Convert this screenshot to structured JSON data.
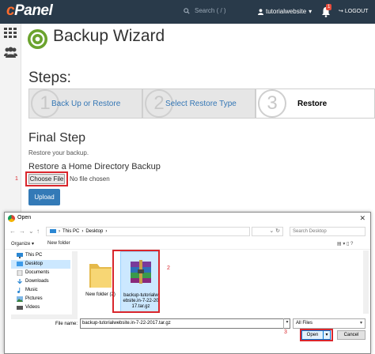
{
  "header": {
    "logo_c": "c",
    "logo_rest": "Panel",
    "search_placeholder": "Search ( / )",
    "username": "tutorialwebsite",
    "notification_count": "1",
    "logout_label": "LOGOUT"
  },
  "page": {
    "title": "Backup Wizard",
    "steps_heading": "Steps:",
    "steps": [
      {
        "num": "1",
        "label": "Back Up or Restore"
      },
      {
        "num": "2",
        "label": "Select Restore Type"
      },
      {
        "num": "3",
        "label": "Restore"
      }
    ],
    "final_step": "Final Step",
    "restore_sub": "Restore your backup.",
    "restore_home": "Restore a Home Directory Backup",
    "choose_file": "Choose File",
    "no_file": "No file chosen",
    "upload": "Upload",
    "callout_1": "1",
    "callout_2": "2",
    "callout_3": "3"
  },
  "dialog": {
    "title": "Open",
    "close": "✕",
    "address_root": "This PC",
    "address_folder": "Desktop",
    "search_placeholder": "Search Desktop",
    "organize": "Organize ▾",
    "new_folder": "New folder",
    "tree": [
      "This PC",
      "Desktop",
      "Documents",
      "Downloads",
      "Music",
      "Pictures",
      "Videos"
    ],
    "files": [
      {
        "name": "New folder (2)",
        "icon": "folder-icon"
      },
      {
        "name": "backup-tutorialwebsite.in-7-22-2017.tar.gz",
        "display": "backup-tutorialw ebsite.in-7-22-20 17.tar.gz",
        "icon": "archive-icon"
      }
    ],
    "filename_label": "File name:",
    "filename_value": "backup-tutorialwebsite.in-7-22-2017.tar.gz",
    "filter": "All Files",
    "open": "Open",
    "cancel": "Cancel"
  },
  "colors": {
    "header_bg": "#293a4a",
    "accent": "#337ab7",
    "callout_red": "#d9262c",
    "selection": "#cce8ff"
  }
}
